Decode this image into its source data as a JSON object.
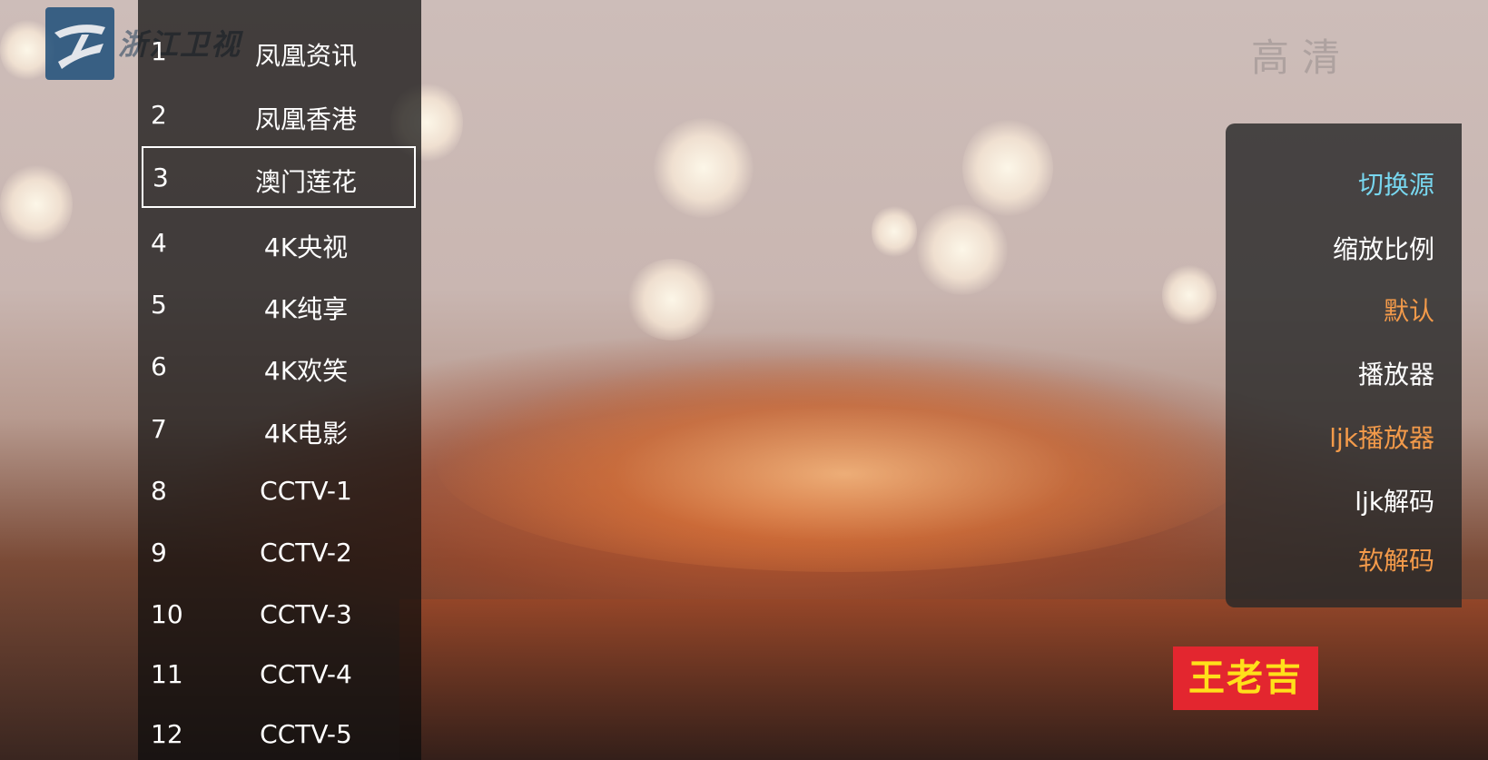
{
  "overlay": {
    "logo_text": "浙江卫视",
    "quality_badge": "高清",
    "watermark": "王老吉"
  },
  "channels": [
    {
      "num": "1",
      "name": "凤凰资讯"
    },
    {
      "num": "2",
      "name": "凤凰香港"
    },
    {
      "num": "3",
      "name": "澳门莲花",
      "selected": true
    },
    {
      "num": "4",
      "name": "4K央视"
    },
    {
      "num": "5",
      "name": "4K纯享"
    },
    {
      "num": "6",
      "name": "4K欢笑"
    },
    {
      "num": "7",
      "name": "4K电影"
    },
    {
      "num": "8",
      "name": "CCTV-1"
    },
    {
      "num": "9",
      "name": "CCTV-2"
    },
    {
      "num": "10",
      "name": "CCTV-3"
    },
    {
      "num": "11",
      "name": "CCTV-4"
    },
    {
      "num": "12",
      "name": "CCTV-5"
    }
  ],
  "settings": [
    {
      "label": "切换源",
      "color": "cyan"
    },
    {
      "label": "缩放比例",
      "color": "white"
    },
    {
      "label": "默认",
      "color": "orange"
    },
    {
      "label": "播放器",
      "color": "white"
    },
    {
      "label": "ljk播放器",
      "color": "orange"
    },
    {
      "label": "ljk解码",
      "color": "white"
    },
    {
      "label": "软解码",
      "color": "orange"
    }
  ],
  "colors": {
    "highlight": "#78d6ee",
    "active_option": "#f39a4a",
    "menu_text": "#ffffff"
  }
}
